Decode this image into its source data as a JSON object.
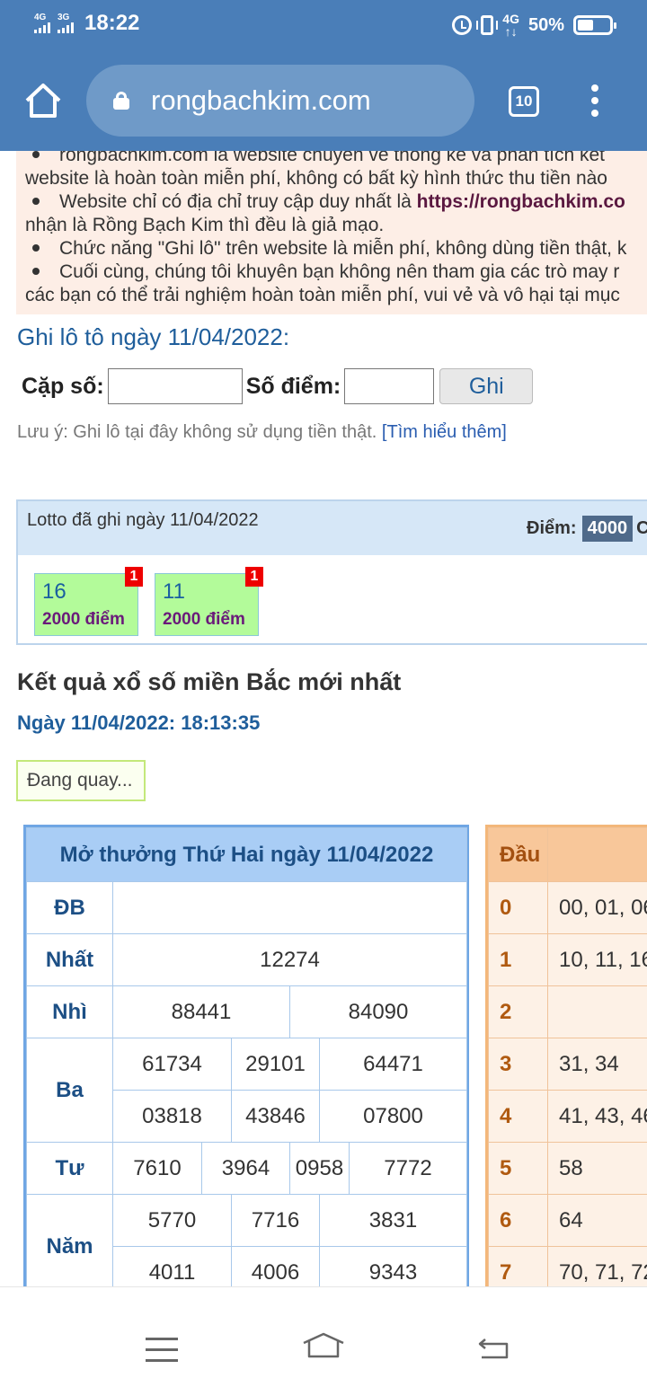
{
  "status_bar": {
    "net1": "4G",
    "net2": "3G",
    "time": "18:22",
    "lte": "4G",
    "battery": "50%"
  },
  "browser": {
    "url": "rongbachkim.com",
    "tab_count": "10"
  },
  "notice": {
    "line1": "rongbachkim.com là website chuyên về thống kê và phân tích kết",
    "line2": "website là hoàn toàn miễn phí, không có bất kỳ hình thức thu tiền nào",
    "line3_prefix": "Website chỉ có địa chỉ truy cập duy nhất là ",
    "line3_link": "https://rongbachkim.co",
    "line4": "nhận là Rồng Bạch Kim thì đều là giả mạo.",
    "line5": "Chức năng \"Ghi lô\" trên website là miễn phí, không dùng tiền thật, k",
    "line6": "Cuối cùng, chúng tôi khuyên bạn không nên tham gia các trò may r",
    "line7": "các bạn có thể trải nghiệm hoàn toàn miễn phí, vui vẻ và vô hại tại mục"
  },
  "ghi_lo": {
    "title": "Ghi lô tô ngày 11/04/2022:",
    "cap_so_label": "Cặp số:",
    "so_diem_label": "Số điểm:",
    "cap_so_value": "",
    "so_diem_value": "",
    "button": "Ghi",
    "note": "Lưu ý: Ghi lô tại đây không sử dụng tiền thật.",
    "note_link": "[Tìm hiểu thêm]"
  },
  "lotto": {
    "title": "Lotto đã ghi ngày 11/04/2022",
    "points_label": "Điểm:",
    "points_value": "4000",
    "points_cut": "C",
    "cards": [
      {
        "num": "16",
        "points": "2000 điểm",
        "badge": "1"
      },
      {
        "num": "11",
        "points": "2000 điểm",
        "badge": "1"
      }
    ]
  },
  "ket_qua": {
    "title": "Kết quả xổ số miền Bắc mới nhất",
    "date": "Ngày 11/04/2022: 18:13:35",
    "status": "Đang quay..."
  },
  "results": {
    "header": "Mở thưởng Thứ Hai ngày 11/04/2022",
    "rows": {
      "db_label": "ĐB",
      "db_value": "",
      "nhat_label": "Nhất",
      "nhat": "12274",
      "nhi_label": "Nhì",
      "nhi": [
        "88441",
        "84090"
      ],
      "ba_label": "Ba",
      "ba": [
        "61734",
        "29101",
        "64471",
        "03818",
        "43846",
        "07800"
      ],
      "tu_label": "Tư",
      "tu": [
        "7610",
        "3964",
        "0958",
        "7772"
      ],
      "nam_label": "Năm",
      "nam": [
        "5770",
        "7716",
        "3831",
        "4011",
        "4006",
        "9343"
      ]
    }
  },
  "dau": {
    "header": "Đầu",
    "rows": [
      {
        "d": "0",
        "v": "00, 01, 06"
      },
      {
        "d": "1",
        "v": "10, 11, 16"
      },
      {
        "d": "2",
        "v": ""
      },
      {
        "d": "3",
        "v": "31, 34"
      },
      {
        "d": "4",
        "v": "41, 43, 46"
      },
      {
        "d": "5",
        "v": "58"
      },
      {
        "d": "6",
        "v": "64"
      },
      {
        "d": "7",
        "v": "70, 71, 72"
      }
    ]
  }
}
